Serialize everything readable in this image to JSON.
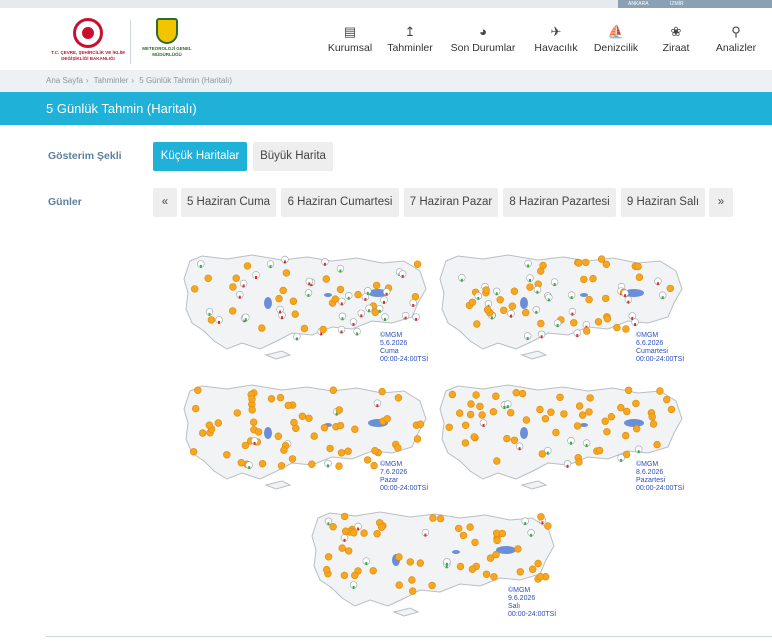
{
  "top_strip": {
    "city_left": "ANKARA",
    "city_right": "İZMİR"
  },
  "logos": {
    "ministry": "T.C. ÇEVRE, ŞEHİRCİLİK VE İKLİM DEĞİŞİKLİĞİ BAKANLIĞI",
    "mgm_badge": "METEOROLOJİ",
    "mgm": "METEOROLOJİ GENEL MÜDÜRLÜĞÜ"
  },
  "nav": [
    {
      "label": "Kurumsal",
      "icon": "document-icon"
    },
    {
      "label": "Tahminler",
      "icon": "chart-line-icon"
    },
    {
      "label": "Son Durumlar",
      "icon": "gauge-icon"
    },
    {
      "label": "Havacılık",
      "icon": "airplane-icon"
    },
    {
      "label": "Denizcilik",
      "icon": "sailboat-icon"
    },
    {
      "label": "Ziraat",
      "icon": "leaf-icon"
    },
    {
      "label": "Analizler",
      "icon": "magnifier-icon"
    }
  ],
  "breadcrumb": [
    "Ana Sayfa",
    "›",
    "Tahminler",
    "›",
    "5 Günlük Tahmin (Haritalı)"
  ],
  "page_title": "5 Günlük Tahmin (Haritalı)",
  "display": {
    "label": "Gösterim Şekli",
    "small": "Küçük Haritalar",
    "large": "Büyük Harita",
    "active": "small"
  },
  "days": {
    "label": "Günler",
    "prev": "«",
    "next": "»",
    "items": [
      "5 Haziran Cuma",
      "6 Haziran Cumartesi",
      "7 Haziran Pazar",
      "8 Haziran Pazartesi",
      "9 Haziran Salı"
    ]
  },
  "maps": [
    {
      "mgm": "©MGM",
      "date": "5.6.2026",
      "day": "Cuma",
      "time": "00:00-24:00TSİ"
    },
    {
      "mgm": "©MGM",
      "date": "6.6.2026",
      "day": "Cumartesi",
      "time": "00:00-24:00TSİ"
    },
    {
      "mgm": "©MGM",
      "date": "7.6.2026",
      "day": "Pazar",
      "time": "00:00-24:00TSİ"
    },
    {
      "mgm": "©MGM",
      "date": "8.6.2026",
      "day": "Pazartesi",
      "time": "00:00-24:00TSİ"
    },
    {
      "mgm": "©MGM",
      "date": "9.6.2026",
      "day": "Salı",
      "time": "00:00-24:00TSİ"
    }
  ],
  "colors": {
    "accent": "#1fb1d8",
    "label": "#5b7fa0",
    "sun": "#f5a623",
    "rain": "#d0312d",
    "leaf": "#3aa845",
    "lake": "#6b8fd6"
  }
}
